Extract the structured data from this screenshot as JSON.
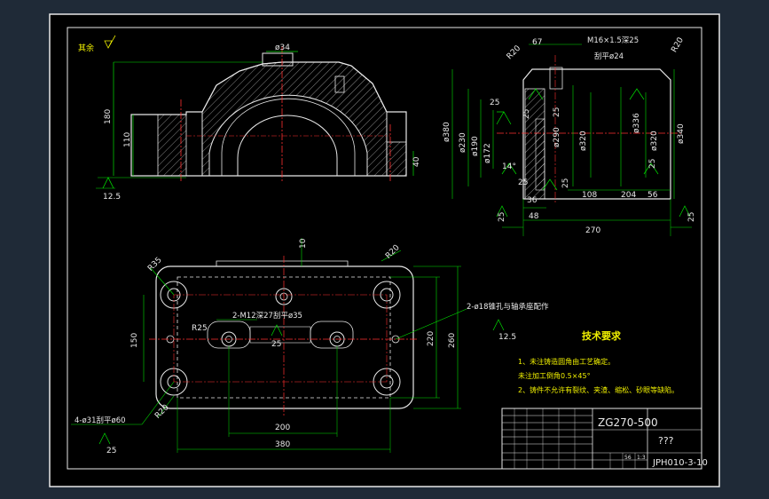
{
  "drawing": {
    "roughness_note": "其余",
    "top_view": {
      "dim_diameter_top": "ø34",
      "dim_height_total": "180",
      "dim_height_mid": "110",
      "dim_base_thickness": "40",
      "roughness": "12.5"
    },
    "side_view": {
      "dim_67": "67",
      "dim_thread": "M16×1.5深25",
      "dim_counterbore": "刮平ø24",
      "dim_r20_left": "R20",
      "dim_r20_right": "R20",
      "dim_d380": "ø380",
      "dim_d230": "ø230",
      "dim_d190": "ø190",
      "dim_d172": "ø172",
      "dim_d290": "ø290",
      "dim_d320a": "ø320",
      "dim_d336": "ø336",
      "dim_d320b": "ø320",
      "dim_d340": "ø340",
      "dim_25a": "25",
      "dim_25b": "25",
      "dim_25c": "25",
      "dim_25d": "25",
      "dim_25e": "25",
      "dim_25f": "25",
      "dim_14": "14°",
      "dim_36": "36",
      "dim_48": "48",
      "dim_108": "108",
      "dim_204": "204",
      "dim_56": "56",
      "dim_270": "270",
      "dim_25_low_left": "25",
      "dim_25_low_right": "25"
    },
    "plan_view": {
      "dim_r35": "R35",
      "dim_r20_top": "R20",
      "dim_10": "10",
      "dim_150": "150",
      "dim_r25": "R25",
      "dim_thread_holes": "2-M12深27刮平ø35",
      "dim_25_center": "25",
      "dim_220": "220",
      "dim_260": "260",
      "dim_200": "200",
      "dim_380": "380",
      "dim_r20_bottom": "R20",
      "dim_bolt_holes": "4-ø31刮平ø60",
      "dim_25_bottom": "25",
      "dim_pin_holes": "2-ø18锥孔与轴承座配作",
      "roughness_right": "12.5"
    },
    "tech": {
      "title": "技术要求",
      "items": [
        "1、未注铸造圆角由工艺确定。",
        "未注加工倒角0.5×45°",
        "2、铸件不允许有裂纹、夹渣、缩松、砂眼等缺陷。"
      ]
    },
    "title_block": {
      "material": "ZG270-500",
      "name": "???",
      "code": "JPH010-3-10",
      "scale": "1:3",
      "qty": "56"
    }
  }
}
